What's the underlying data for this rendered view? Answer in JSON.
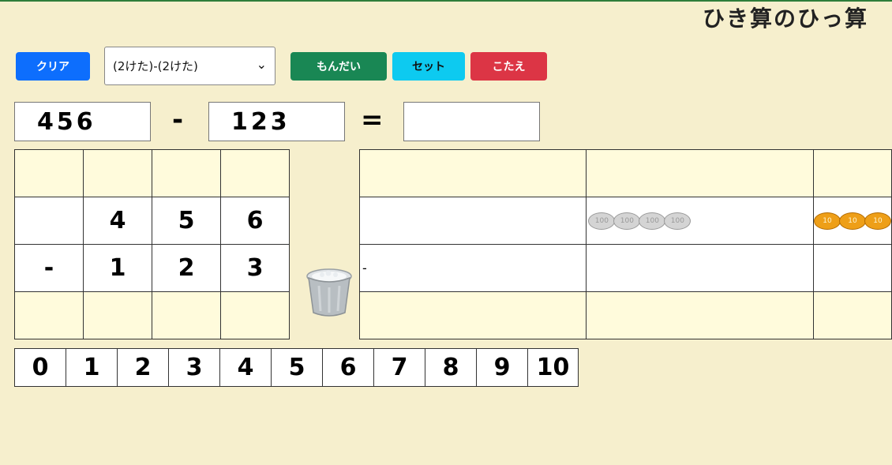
{
  "title": "ひき算のひっ算",
  "toolbar": {
    "clear_label": "クリア",
    "mode_selected": "(2けた)-(2けた)",
    "question_label": "もんだい",
    "set_label": "セット",
    "answer_label": "こたえ"
  },
  "equation": {
    "a": "456",
    "op": "-",
    "b": "123",
    "eq": "=",
    "answer": ""
  },
  "calc_grid": {
    "rows": [
      [
        "",
        "",
        "",
        ""
      ],
      [
        "",
        "4",
        "5",
        "6"
      ],
      [
        "-",
        "1",
        "2",
        "3"
      ],
      [
        "",
        "",
        "",
        ""
      ]
    ]
  },
  "coin_board": {
    "minus_mark": "-",
    "hundreds_coins": [
      "100",
      "100",
      "100",
      "100"
    ],
    "tens_coins": [
      "10",
      "10",
      "10"
    ]
  },
  "digit_pad": [
    "0",
    "1",
    "2",
    "3",
    "4",
    "5",
    "6",
    "7",
    "8",
    "9",
    "10"
  ],
  "colors": {
    "background": "#f6efcd",
    "clear": "#0d6efd",
    "question": "#198754",
    "set": "#0dcaf0",
    "answer": "#dc3545"
  }
}
